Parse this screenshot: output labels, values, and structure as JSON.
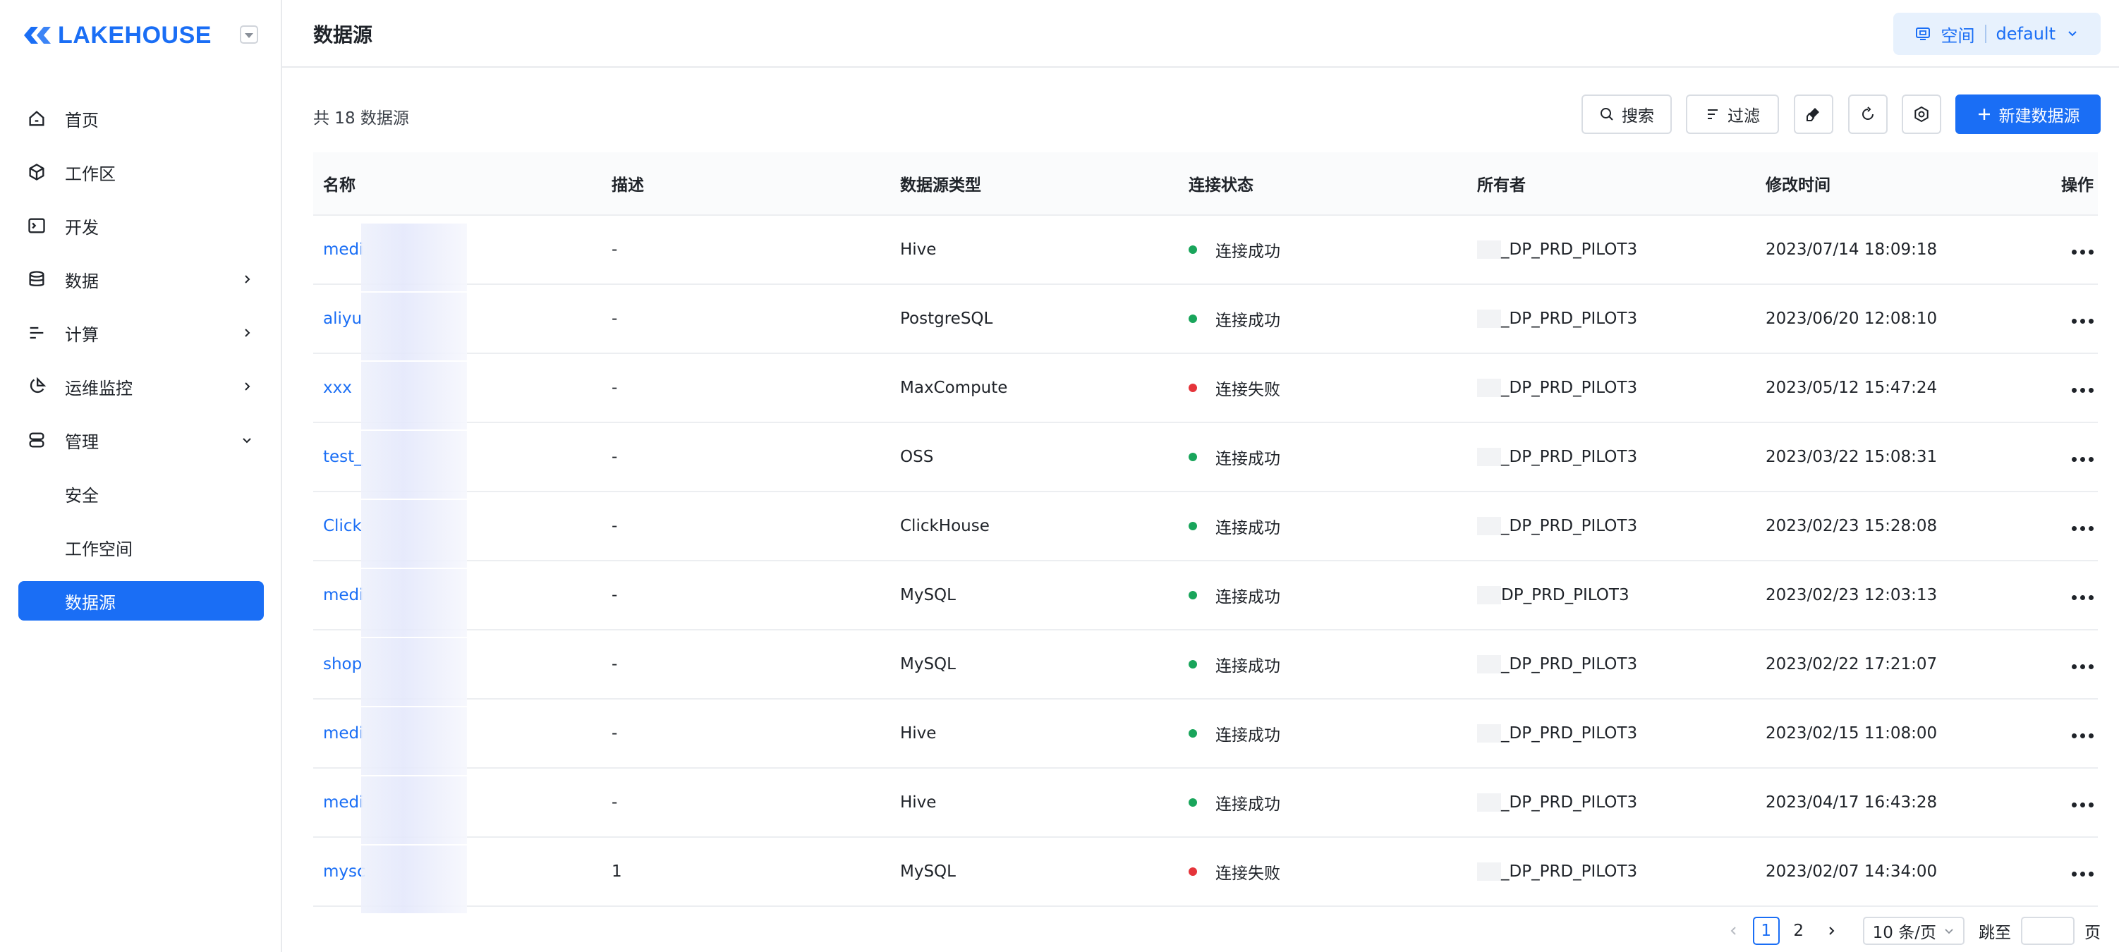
{
  "brand": {
    "name": "LAKEHOUSE",
    "color": "#1a6ef5"
  },
  "sidebar": {
    "items": [
      {
        "label": "首页",
        "icon": "home-icon",
        "has_chevron": false
      },
      {
        "label": "工作区",
        "icon": "cube-icon",
        "has_chevron": false
      },
      {
        "label": "开发",
        "icon": "terminal-icon",
        "has_chevron": false
      },
      {
        "label": "数据",
        "icon": "database-icon",
        "has_chevron": true
      },
      {
        "label": "计算",
        "icon": "compute-icon",
        "has_chevron": true
      },
      {
        "label": "运维监控",
        "icon": "monitor-icon",
        "has_chevron": true
      },
      {
        "label": "管理",
        "icon": "server-icon",
        "has_chevron": true,
        "expanded": true
      }
    ],
    "sub_items": [
      {
        "label": "安全",
        "active": false
      },
      {
        "label": "工作空间",
        "active": false
      },
      {
        "label": "数据源",
        "active": true
      }
    ]
  },
  "header": {
    "title": "数据源",
    "space_label": "空间",
    "space_value": "default"
  },
  "toolbar": {
    "count_text": "共 18 数据源",
    "search_label": "搜索",
    "filter_label": "过滤",
    "new_label": "新建数据源"
  },
  "table": {
    "columns": [
      "名称",
      "描述",
      "数据源类型",
      "连接状态",
      "所有者",
      "修改时间",
      "操作"
    ],
    "rows": [
      {
        "name": "medi",
        "desc": "-",
        "type": "Hive",
        "status": "连接成功",
        "ok": true,
        "owner": "_DP_PRD_PILOT3",
        "time": "2023/07/14 18:09:18"
      },
      {
        "name": "aliyu",
        "desc": "-",
        "type": "PostgreSQL",
        "status": "连接成功",
        "ok": true,
        "owner": "_DP_PRD_PILOT3",
        "time": "2023/06/20 12:08:10"
      },
      {
        "name": "xxx",
        "desc": "-",
        "type": "MaxCompute",
        "status": "连接失败",
        "ok": false,
        "owner": "_DP_PRD_PILOT3",
        "time": "2023/05/12 15:47:24"
      },
      {
        "name": "test_",
        "desc": "-",
        "type": "OSS",
        "status": "连接成功",
        "ok": true,
        "owner": "_DP_PRD_PILOT3",
        "time": "2023/03/22 15:08:31"
      },
      {
        "name": "Click",
        "desc": "-",
        "type": "ClickHouse",
        "status": "连接成功",
        "ok": true,
        "owner": "_DP_PRD_PILOT3",
        "time": "2023/02/23 15:28:08"
      },
      {
        "name": "medi",
        "desc": "-",
        "type": "MySQL",
        "status": "连接成功",
        "ok": true,
        "owner": "DP_PRD_PILOT3",
        "time": "2023/02/23 12:03:13"
      },
      {
        "name": "shop",
        "desc": "-",
        "type": "MySQL",
        "status": "连接成功",
        "ok": true,
        "owner": "_DP_PRD_PILOT3",
        "time": "2023/02/22 17:21:07"
      },
      {
        "name": "medi",
        "desc": "-",
        "type": "Hive",
        "status": "连接成功",
        "ok": true,
        "owner": "_DP_PRD_PILOT3",
        "time": "2023/02/15 11:08:00"
      },
      {
        "name": "medi",
        "desc": "-",
        "type": "Hive",
        "status": "连接成功",
        "ok": true,
        "owner": "_DP_PRD_PILOT3",
        "time": "2023/04/17 16:43:28"
      },
      {
        "name": "mysc",
        "desc": "1",
        "type": "MySQL",
        "status": "连接失败",
        "ok": false,
        "owner": "_DP_PRD_PILOT3",
        "time": "2023/02/07 14:34:00"
      }
    ]
  },
  "status_colors": {
    "ok": "#19a55b",
    "fail": "#e5343a"
  },
  "pagination": {
    "pages": [
      "1",
      "2"
    ],
    "current": "1",
    "page_size": "10 条/页",
    "jump_label": "跳至",
    "page_suffix": "页"
  }
}
